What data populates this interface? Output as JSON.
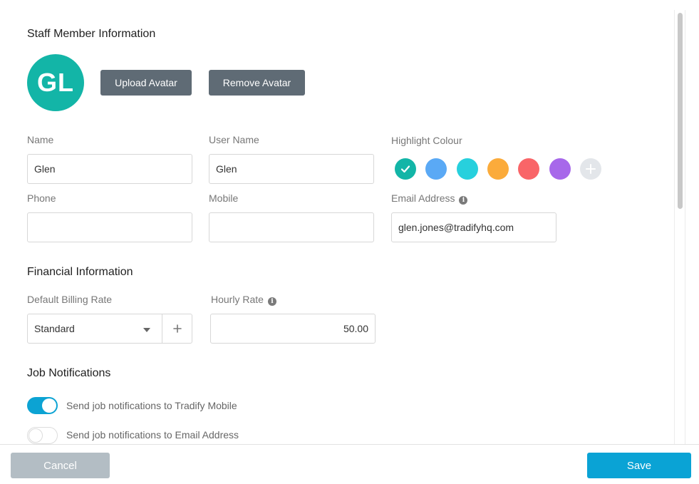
{
  "staff_section": {
    "title": "Staff Member Information",
    "avatar_initials": "GL",
    "avatar_color": "#13b5a7",
    "upload_avatar_label": "Upload Avatar",
    "remove_avatar_label": "Remove Avatar"
  },
  "fields": {
    "name": {
      "label": "Name",
      "value": "Glen"
    },
    "user_name": {
      "label": "User Name",
      "value": "Glen"
    },
    "phone": {
      "label": "Phone",
      "value": ""
    },
    "mobile": {
      "label": "Mobile",
      "value": ""
    },
    "email": {
      "label": "Email Address",
      "value": "glen.jones@tradifyhq.com",
      "icon": "info-icon"
    }
  },
  "highlight_colour": {
    "label": "Highlight Colour",
    "swatches": [
      {
        "color": "#13b5a7",
        "selected": true
      },
      {
        "color": "#5aa9f5",
        "selected": false
      },
      {
        "color": "#27d0dd",
        "selected": false
      },
      {
        "color": "#fbab3b",
        "selected": false
      },
      {
        "color": "#f96568",
        "selected": false
      },
      {
        "color": "#a768ea",
        "selected": false
      }
    ],
    "add_icon": "plus-icon"
  },
  "financial_section": {
    "title": "Financial Information",
    "billing_rate_label": "Default Billing Rate",
    "billing_rate_value": "Standard",
    "hourly_rate_label": "Hourly Rate",
    "hourly_rate_value": "50.00"
  },
  "notifications_section": {
    "title": "Job Notifications",
    "items": [
      {
        "label": "Send job notifications to Tradify Mobile",
        "enabled": true
      },
      {
        "label": "Send job notifications to Email Address",
        "enabled": false
      }
    ]
  },
  "footer": {
    "cancel_label": "Cancel",
    "save_label": "Save"
  }
}
